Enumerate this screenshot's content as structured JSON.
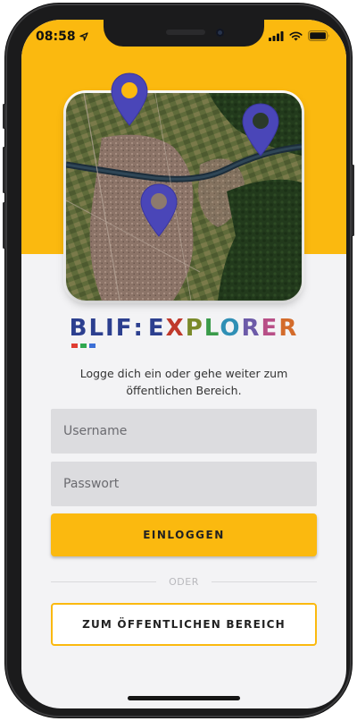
{
  "status_bar": {
    "time": "08:58",
    "location_icon": "location-arrow-icon",
    "signal_icon": "cellular-signal-icon",
    "wifi_icon": "wifi-icon",
    "battery_icon": "battery-icon"
  },
  "map": {
    "pin_icon": "map-pin-icon",
    "pin_color": "#4a46b8"
  },
  "logo": {
    "part1": "BLIF",
    "separator": ":",
    "part2": "EXPLORER",
    "colors": [
      "#2c3f8f",
      "#c0392b",
      "#7a8a2a",
      "#3a9b4a",
      "#2f8fb5",
      "#6c5aa8",
      "#b84f87",
      "#d36b2b"
    ],
    "dot_colors": [
      "#e03c31",
      "#2fa84f",
      "#3b6fd6"
    ]
  },
  "login": {
    "subtitle": "Logge dich ein oder gehe weiter zum öffentlichen Bereich.",
    "username_placeholder": "Username",
    "password_placeholder": "Passwort",
    "login_button": "EINLOGGEN",
    "divider": "ODER",
    "public_button": "ZUM ÖFFENTLICHEN BEREICH"
  },
  "colors": {
    "accent": "#fbb90f",
    "background": "#f3f3f5",
    "input_bg": "#dcdcdf"
  }
}
